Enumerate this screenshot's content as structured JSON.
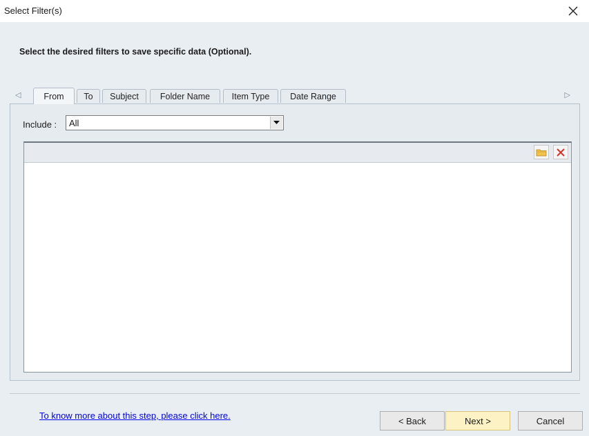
{
  "window": {
    "title": "Select Filter(s)",
    "close_glyph": "✕"
  },
  "description": "Select the desired filters to save specific data (Optional).",
  "tabs": [
    {
      "label": "From",
      "active": true
    },
    {
      "label": "To",
      "active": false
    },
    {
      "label": "Subject",
      "active": false
    },
    {
      "label": "Folder Name",
      "active": false
    },
    {
      "label": "Item Type",
      "active": false
    },
    {
      "label": "Date Range",
      "active": false
    }
  ],
  "tab_arrows": {
    "left": "◁",
    "right": "▷"
  },
  "filter": {
    "include_label": "Include :",
    "include_value": "All",
    "dropdown_glyph": "▼"
  },
  "list_toolbar": {
    "icons": [
      "folder-open-icon",
      "delete-x-icon"
    ]
  },
  "footer": {
    "help_link": "To know more about this step, please click here.",
    "back_label": "< Back",
    "next_label": "Next >",
    "cancel_label": "Cancel"
  },
  "colors": {
    "dialog_background": "#e9eef3",
    "next_button": "#fdf2c4",
    "link": "#0000ee",
    "delete_icon": "#d9342b",
    "folder_icon": "#f0c24b"
  }
}
